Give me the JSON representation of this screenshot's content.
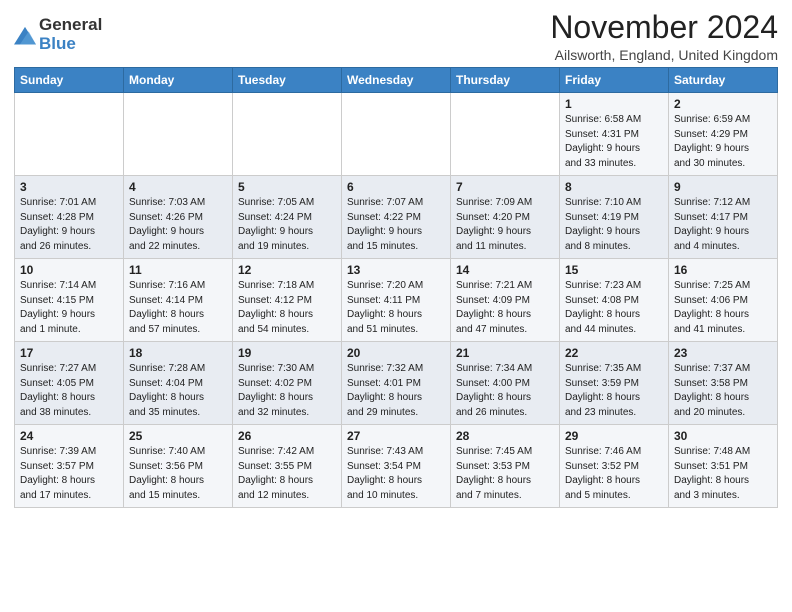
{
  "logo": {
    "general": "General",
    "blue": "Blue"
  },
  "title": {
    "month": "November 2024",
    "location": "Ailsworth, England, United Kingdom"
  },
  "weekdays": [
    "Sunday",
    "Monday",
    "Tuesday",
    "Wednesday",
    "Thursday",
    "Friday",
    "Saturday"
  ],
  "weeks": [
    [
      {
        "day": "",
        "info": ""
      },
      {
        "day": "",
        "info": ""
      },
      {
        "day": "",
        "info": ""
      },
      {
        "day": "",
        "info": ""
      },
      {
        "day": "",
        "info": ""
      },
      {
        "day": "1",
        "info": "Sunrise: 6:58 AM\nSunset: 4:31 PM\nDaylight: 9 hours\nand 33 minutes."
      },
      {
        "day": "2",
        "info": "Sunrise: 6:59 AM\nSunset: 4:29 PM\nDaylight: 9 hours\nand 30 minutes."
      }
    ],
    [
      {
        "day": "3",
        "info": "Sunrise: 7:01 AM\nSunset: 4:28 PM\nDaylight: 9 hours\nand 26 minutes."
      },
      {
        "day": "4",
        "info": "Sunrise: 7:03 AM\nSunset: 4:26 PM\nDaylight: 9 hours\nand 22 minutes."
      },
      {
        "day": "5",
        "info": "Sunrise: 7:05 AM\nSunset: 4:24 PM\nDaylight: 9 hours\nand 19 minutes."
      },
      {
        "day": "6",
        "info": "Sunrise: 7:07 AM\nSunset: 4:22 PM\nDaylight: 9 hours\nand 15 minutes."
      },
      {
        "day": "7",
        "info": "Sunrise: 7:09 AM\nSunset: 4:20 PM\nDaylight: 9 hours\nand 11 minutes."
      },
      {
        "day": "8",
        "info": "Sunrise: 7:10 AM\nSunset: 4:19 PM\nDaylight: 9 hours\nand 8 minutes."
      },
      {
        "day": "9",
        "info": "Sunrise: 7:12 AM\nSunset: 4:17 PM\nDaylight: 9 hours\nand 4 minutes."
      }
    ],
    [
      {
        "day": "10",
        "info": "Sunrise: 7:14 AM\nSunset: 4:15 PM\nDaylight: 9 hours\nand 1 minute."
      },
      {
        "day": "11",
        "info": "Sunrise: 7:16 AM\nSunset: 4:14 PM\nDaylight: 8 hours\nand 57 minutes."
      },
      {
        "day": "12",
        "info": "Sunrise: 7:18 AM\nSunset: 4:12 PM\nDaylight: 8 hours\nand 54 minutes."
      },
      {
        "day": "13",
        "info": "Sunrise: 7:20 AM\nSunset: 4:11 PM\nDaylight: 8 hours\nand 51 minutes."
      },
      {
        "day": "14",
        "info": "Sunrise: 7:21 AM\nSunset: 4:09 PM\nDaylight: 8 hours\nand 47 minutes."
      },
      {
        "day": "15",
        "info": "Sunrise: 7:23 AM\nSunset: 4:08 PM\nDaylight: 8 hours\nand 44 minutes."
      },
      {
        "day": "16",
        "info": "Sunrise: 7:25 AM\nSunset: 4:06 PM\nDaylight: 8 hours\nand 41 minutes."
      }
    ],
    [
      {
        "day": "17",
        "info": "Sunrise: 7:27 AM\nSunset: 4:05 PM\nDaylight: 8 hours\nand 38 minutes."
      },
      {
        "day": "18",
        "info": "Sunrise: 7:28 AM\nSunset: 4:04 PM\nDaylight: 8 hours\nand 35 minutes."
      },
      {
        "day": "19",
        "info": "Sunrise: 7:30 AM\nSunset: 4:02 PM\nDaylight: 8 hours\nand 32 minutes."
      },
      {
        "day": "20",
        "info": "Sunrise: 7:32 AM\nSunset: 4:01 PM\nDaylight: 8 hours\nand 29 minutes."
      },
      {
        "day": "21",
        "info": "Sunrise: 7:34 AM\nSunset: 4:00 PM\nDaylight: 8 hours\nand 26 minutes."
      },
      {
        "day": "22",
        "info": "Sunrise: 7:35 AM\nSunset: 3:59 PM\nDaylight: 8 hours\nand 23 minutes."
      },
      {
        "day": "23",
        "info": "Sunrise: 7:37 AM\nSunset: 3:58 PM\nDaylight: 8 hours\nand 20 minutes."
      }
    ],
    [
      {
        "day": "24",
        "info": "Sunrise: 7:39 AM\nSunset: 3:57 PM\nDaylight: 8 hours\nand 17 minutes."
      },
      {
        "day": "25",
        "info": "Sunrise: 7:40 AM\nSunset: 3:56 PM\nDaylight: 8 hours\nand 15 minutes."
      },
      {
        "day": "26",
        "info": "Sunrise: 7:42 AM\nSunset: 3:55 PM\nDaylight: 8 hours\nand 12 minutes."
      },
      {
        "day": "27",
        "info": "Sunrise: 7:43 AM\nSunset: 3:54 PM\nDaylight: 8 hours\nand 10 minutes."
      },
      {
        "day": "28",
        "info": "Sunrise: 7:45 AM\nSunset: 3:53 PM\nDaylight: 8 hours\nand 7 minutes."
      },
      {
        "day": "29",
        "info": "Sunrise: 7:46 AM\nSunset: 3:52 PM\nDaylight: 8 hours\nand 5 minutes."
      },
      {
        "day": "30",
        "info": "Sunrise: 7:48 AM\nSunset: 3:51 PM\nDaylight: 8 hours\nand 3 minutes."
      }
    ]
  ]
}
